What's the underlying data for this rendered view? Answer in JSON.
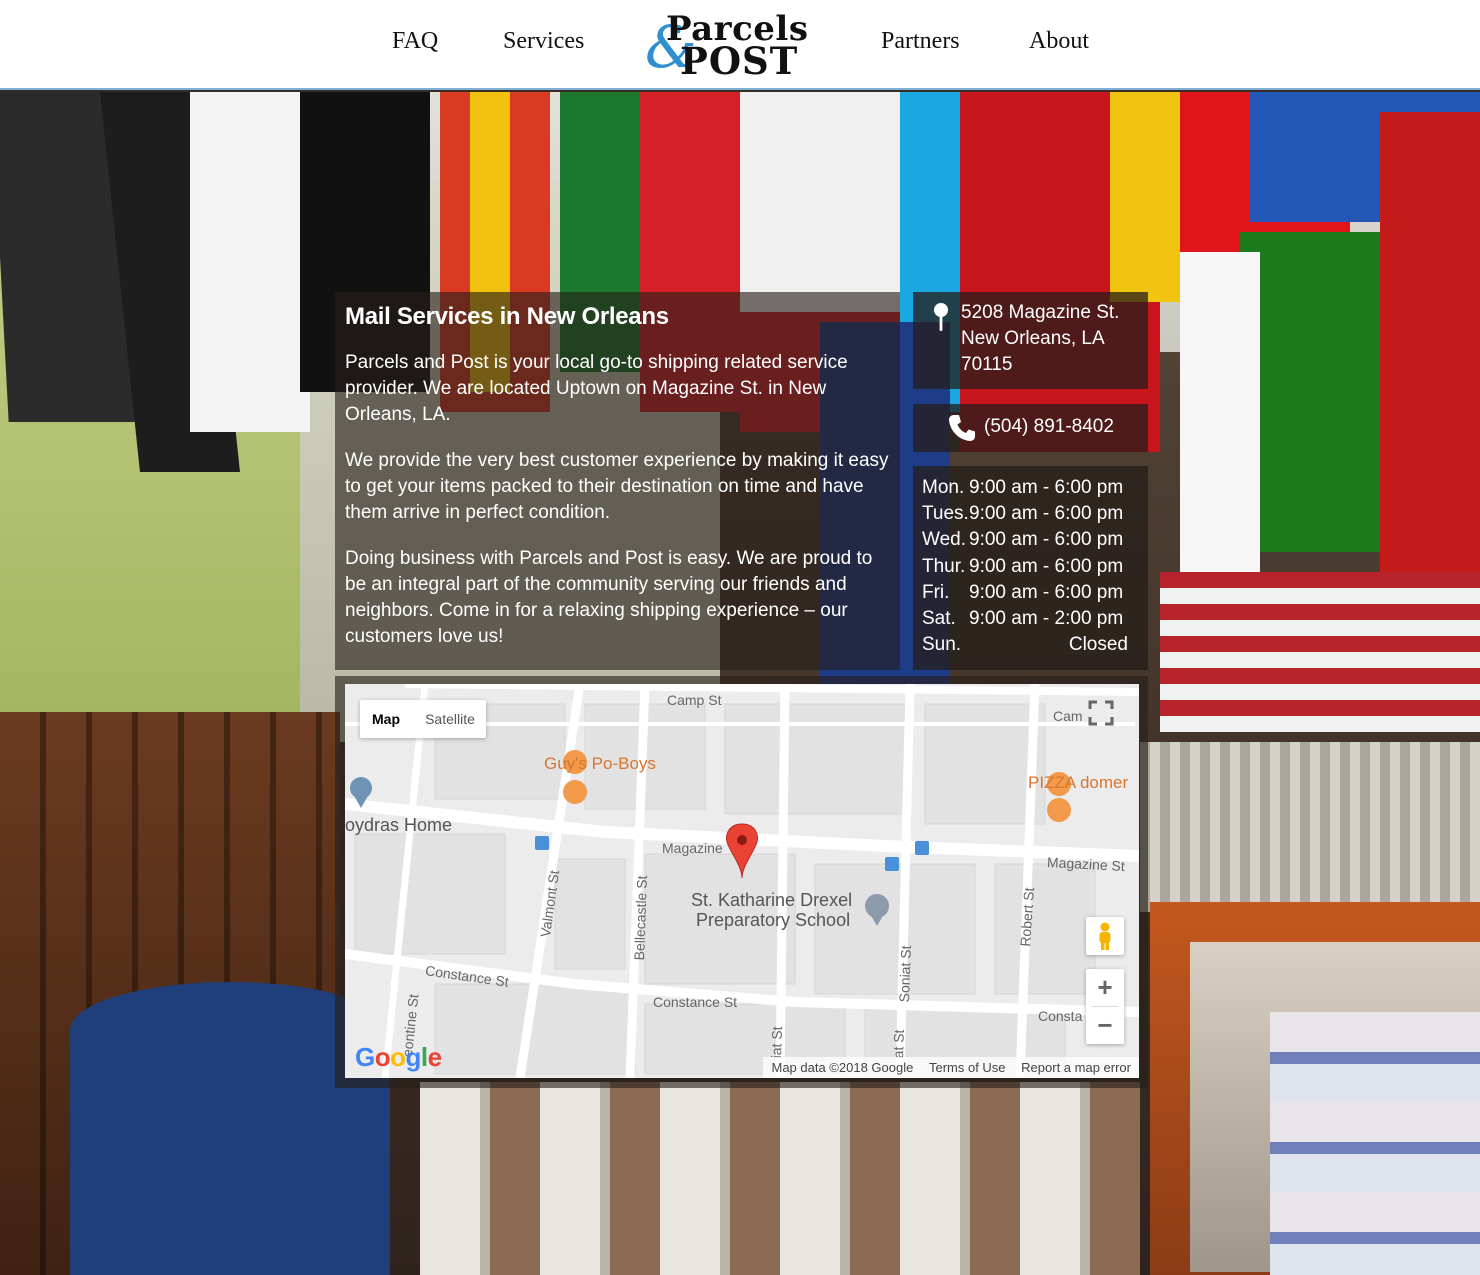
{
  "header": {
    "nav": {
      "faq": "FAQ",
      "services": "Services",
      "partners": "Partners",
      "about": "About"
    },
    "logo": {
      "ampersand": "&",
      "word1": "Parcels",
      "word2": "POST"
    }
  },
  "info": {
    "title": "Mail Services in New Orleans",
    "paragraphs": [
      "Parcels and Post is your local go-to shipping related service provider. We are located Uptown on Magazine St. in New Orleans, LA.",
      "We provide the very best customer experience by making it easy to get your items packed to their destination on time and have them arrive in perfect condition.",
      "Doing business with Parcels and Post is easy. We are proud to be an integral part of the community serving our friends and neighbors. Come in for a relaxing shipping experience – our customers love us!"
    ]
  },
  "contact": {
    "address_line1": "5208 Magazine St.",
    "address_line2": "New Orleans, LA",
    "address_line3": "70115",
    "phone": "(504) 891-8402",
    "pin_icon": "map-pin-icon",
    "phone_icon": "phone-icon"
  },
  "hours": [
    {
      "day": "Mon.",
      "time": "9:00 am - 6:00 pm"
    },
    {
      "day": "Tues.",
      "time": "9:00 am - 6:00 pm"
    },
    {
      "day": "Wed.",
      "time": "9:00 am - 6:00 pm"
    },
    {
      "day": "Thur.",
      "time": "9:00 am - 6:00 pm"
    },
    {
      "day": "Fri.",
      "time": "9:00 am - 6:00 pm"
    },
    {
      "day": "Sat.",
      "time": "9:00 am - 2:00 pm"
    },
    {
      "day": "Sun.",
      "time": "Closed"
    }
  ],
  "map": {
    "type_map": "Map",
    "type_satellite": "Satellite",
    "labels": {
      "camp_st": "Camp St",
      "camp_st_right": "Cam",
      "guys": "Guy's Po-Boys",
      "pizza": "PIZZA domer",
      "home": "oydras Home",
      "magazine_center": "Magazine",
      "magazine_right": "Magazine St",
      "valmont": "Valmont St",
      "bellecastle": "Bellecastle St",
      "school_line1": "St. Katharine Drexel",
      "school_line2": "Preparatory School",
      "robert": "Robert St",
      "soniat": "Soniat St",
      "constance_left": "Constance St",
      "constance_center": "Constance St",
      "constance_right": "Consta",
      "fontine": "eontine St",
      "bottom_st1": "iat St",
      "bottom_st2": "at St"
    },
    "zoom_in": "+",
    "zoom_out": "−",
    "google": "Google",
    "footer": {
      "data": "Map data ©2018 Google",
      "terms": "Terms of Use",
      "report": "Report a map error"
    },
    "colors": {
      "road": "#ffffff",
      "block": "#e6e6e6",
      "marker": "#ea4335",
      "poi": "#d8762d",
      "transit": "#4a90d9"
    }
  }
}
